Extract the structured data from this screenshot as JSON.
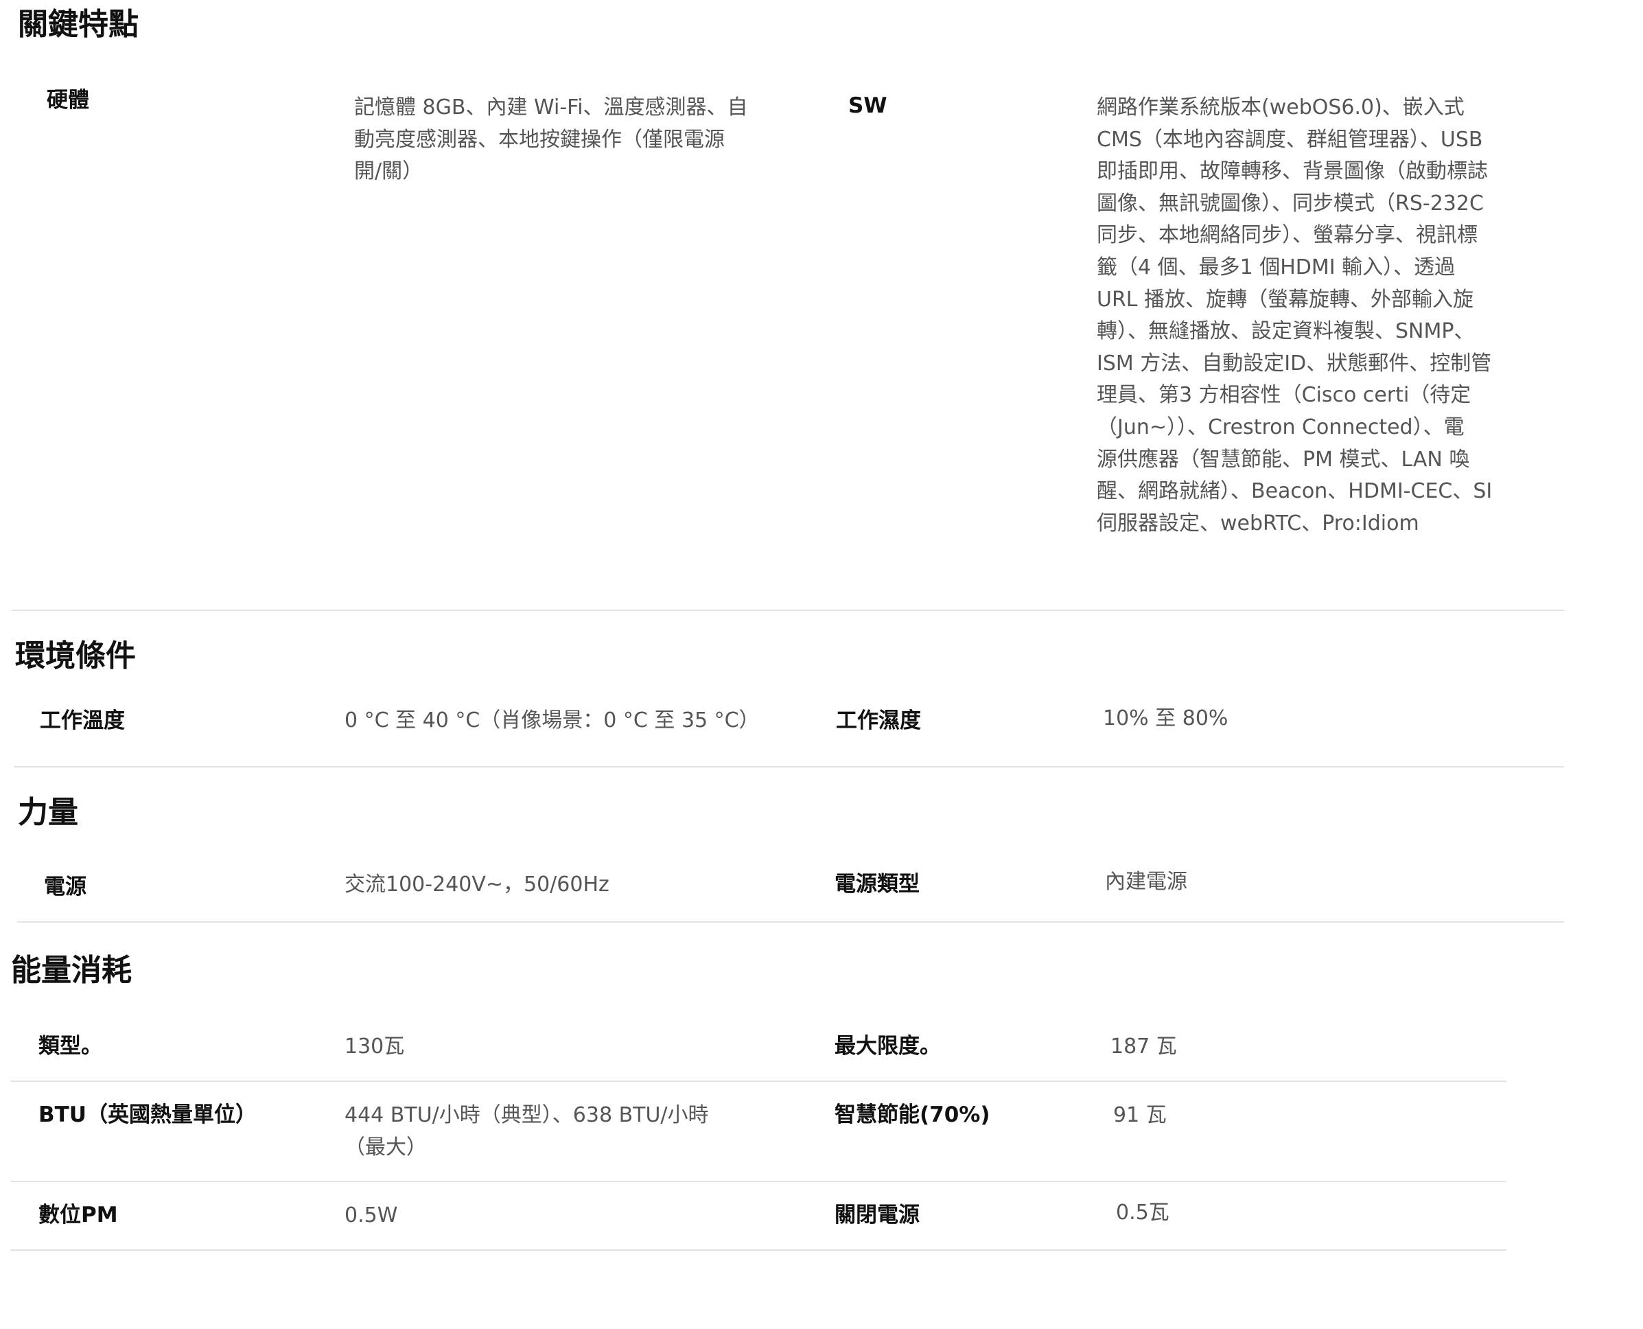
{
  "key_features": {
    "title": "關鍵特點",
    "hardware_label": "硬體",
    "hardware_lines": [
      "記憶體 8GB、內建 Wi-Fi、溫度感測器、自",
      "動亮度感測器、本地按鍵操作（僅限電源",
      "開/關）"
    ],
    "sw_label": "SW",
    "sw_lines": [
      "網路作業系統版本(webOS6.0)、嵌入式",
      "CMS（本地內容調度、群組管理器）、USB",
      "即插即用、故障轉移、背景圖像（啟動標誌",
      "圖像、無訊號圖像）、同步模式（RS-232C",
      "同步、本地網絡同步）、螢幕分享、視訊標",
      "籤（4 個、最多1 個HDMI 輸入）、透過",
      "URL 播放、旋轉（螢幕旋轉、外部輸入旋",
      "轉）、無縫播放、設定資料複製、SNMP、",
      "ISM 方法、自動設定ID、狀態郵件、控制管",
      "理員、第3 方相容性（Cisco certi（待定",
      "（Jun~））、Crestron Connected）、電",
      "源供應器（智慧節能、PM 模式、LAN 喚",
      "醒、網路就緒）、Beacon、HDMI-CEC、SI",
      "伺服器設定、webRTC、Pro:Idiom"
    ]
  },
  "environment": {
    "title": "環境條件",
    "op_temp_label": "工作溫度",
    "op_temp_value": "0 °C 至 40 °C（肖像場景：0 °C 至 35 °C）",
    "op_humidity_label": "工作濕度",
    "op_humidity_value": "10% 至 80%"
  },
  "power": {
    "title": "力量",
    "supply_label": "電源",
    "supply_value": "交流100-240V~，50/60Hz",
    "supply_type_label": "電源類型",
    "supply_type_value": "內建電源"
  },
  "consumption": {
    "title": "能量消耗",
    "typical_label": "類型。",
    "typical_value": "130瓦",
    "max_label": "最大限度。",
    "max_value": "187 瓦",
    "btu_label": "BTU（英國熱量單位）",
    "btu_lines": [
      "444 BTU/小時（典型）、638 BTU/小時",
      "（最大）"
    ],
    "smart_label": "智慧節能(70%)",
    "smart_value": "91 瓦",
    "dpm_label": "數位PM",
    "dpm_value": "0.5W",
    "off_label": "關閉電源",
    "off_value": "0.5瓦"
  }
}
